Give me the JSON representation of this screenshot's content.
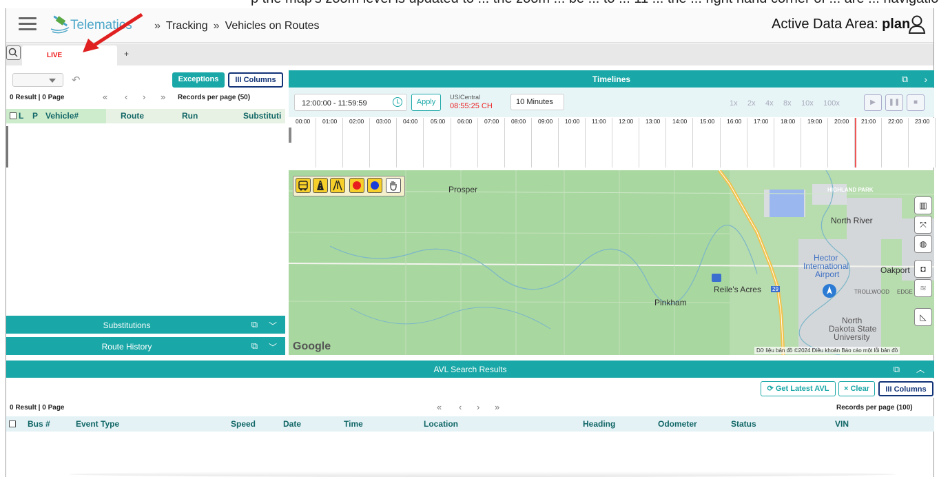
{
  "top_caption": "p the map's zoom level is updated to ... the zoom ... be ... to ... 11 ... the ... right hand corner of ... are ... navigation ...",
  "app": {
    "logo_text": "Telematics",
    "breadcrumb": [
      "Tracking",
      "Vehicles on Routes"
    ],
    "active_area_label": "Active Data Area:",
    "active_area_value": "plan"
  },
  "tabs": {
    "live": "LIVE",
    "add": "+"
  },
  "left": {
    "exceptions": "Exceptions",
    "columns": "III Columns",
    "result": "0 Result | 0 Page",
    "records_per_page": "Records per page (50)",
    "headers": [
      "L",
      "P",
      "Vehicle#",
      "Route",
      "Run",
      "Substituti"
    ],
    "substitutions": "Substitutions",
    "route_history": "Route History"
  },
  "timeline": {
    "title": "Timelines",
    "range_start": "12:00:00",
    "range_end": "11:59:59",
    "apply": "Apply",
    "tz": "US/Central",
    "clock": "08:55:25 CH",
    "minutes_value": "10",
    "minutes_label": "Minutes",
    "speeds": [
      "1x",
      "2x",
      "4x",
      "8x",
      "10x",
      "100x"
    ],
    "hours": [
      "00:00",
      "01:00",
      "02:00",
      "03:00",
      "04:00",
      "05:00",
      "06:00",
      "07:00",
      "08:00",
      "09:00",
      "10:00",
      "11:00",
      "12:00",
      "13:00",
      "14:00",
      "15:00",
      "16:00",
      "17:00",
      "18:00",
      "19:00",
      "20:00",
      "21:00",
      "22:00",
      "23:00"
    ]
  },
  "map": {
    "labels": {
      "prosper": "Prosper",
      "highland_park": "HIGHLAND PARK",
      "north_river": "North River",
      "hector": "Hector",
      "international": "International",
      "airport": "Airport",
      "oakport": "Oakport",
      "reiles": "Reile's Acres",
      "pinkham": "Pinkham",
      "trollwood": "TROLLWOOD",
      "edge": "EDGE",
      "nd1": "North",
      "nd2": "Dakota State",
      "nd3": "University",
      "hwy": "29"
    },
    "google": "Google",
    "footer": "Dữ liệu bản đồ ©2024   Điều khoản   Báo cáo một lỗi bản đồ"
  },
  "avl": {
    "title": "AVL Search Results",
    "get_latest": "Get Latest AVL",
    "clear": "Clear",
    "columns": "III Columns",
    "result": "0 Result | 0 Page",
    "records_per_page": "Records per page (100)",
    "headers": [
      "Bus #",
      "Event Type",
      "Speed",
      "Date",
      "Time",
      "Location",
      "Heading",
      "Odometer",
      "Status",
      "VIN"
    ]
  }
}
